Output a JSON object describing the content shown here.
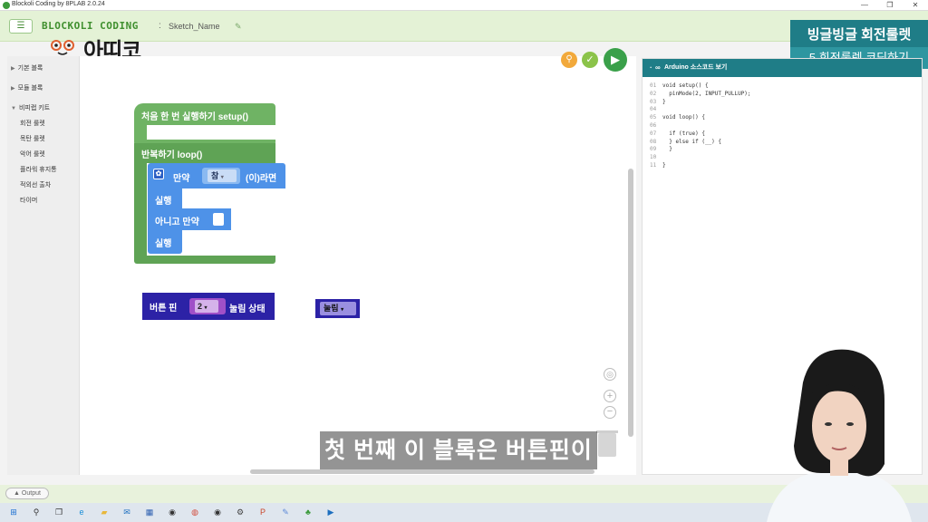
{
  "window": {
    "title": "Blockoli Coding by 8PLAB 2.0.24",
    "controls": [
      "—",
      "❐",
      "✕"
    ]
  },
  "header": {
    "brand": "BLOCKOLI CODING",
    "separator": ":",
    "sketch_name": "Sketch_Name",
    "watermark": "아띠코"
  },
  "overlay": {
    "title": "빙글빙글 회전룰렛",
    "subtitle": "5.회전룰렛 코딩하기"
  },
  "palette": {
    "categories": [
      {
        "label": "기본 블록",
        "expanded": false
      },
      {
        "label": "모듈 블록",
        "expanded": false
      },
      {
        "label": "비피랩 키트",
        "expanded": true
      }
    ],
    "kit_items": [
      "회전 룰렛",
      "목탄 룰렛",
      "악어 룰렛",
      "플라워 휴지통",
      "적외선 출차",
      "타이머"
    ]
  },
  "blocks": {
    "setup_label": "처음 한 번 실행하기 setup()",
    "loop_label": "반복하기 loop()",
    "if_label": "만약",
    "if_condition": "참",
    "if_then": "(이)라면",
    "do_label_1": "실행",
    "elseif_label": "아니고 만약",
    "do_label_2": "실행",
    "button_pin_label": "버튼 핀",
    "button_pin_value": "2",
    "button_state_label": "눌림 상태",
    "pressed_value": "눌림"
  },
  "code_panel": {
    "header": "Arduino 소스코드 보기",
    "lines": [
      {
        "n": "01",
        "t": "void setup() {"
      },
      {
        "n": "02",
        "t": "  pinMode(2, INPUT_PULLUP);"
      },
      {
        "n": "03",
        "t": "}"
      },
      {
        "n": "04",
        "t": ""
      },
      {
        "n": "05",
        "t": "void loop() {"
      },
      {
        "n": "06",
        "t": ""
      },
      {
        "n": "07",
        "t": "  if (true) {"
      },
      {
        "n": "08",
        "t": "  } else if (__) {"
      },
      {
        "n": "09",
        "t": "  }"
      },
      {
        "n": "10",
        "t": ""
      },
      {
        "n": "11",
        "t": "}"
      }
    ]
  },
  "output": {
    "label": "Output"
  },
  "subtitle": "첫 번째 이 블록은 버튼핀이",
  "colors": {
    "header_green": "#e4f2d6",
    "block_green": "#6fb364",
    "block_blue": "#4e92e8",
    "block_navy": "#2c22a6",
    "teal": "#1f7d87"
  },
  "taskbar_icons": [
    "windows-icon",
    "search-icon",
    "taskview-icon",
    "edge-icon",
    "folder-icon",
    "mail-icon",
    "store-icon",
    "app-icon",
    "chrome-icon",
    "app-icon",
    "settings-icon",
    "powerpoint-icon",
    "paint-icon",
    "blockoli-icon",
    "video-icon"
  ]
}
